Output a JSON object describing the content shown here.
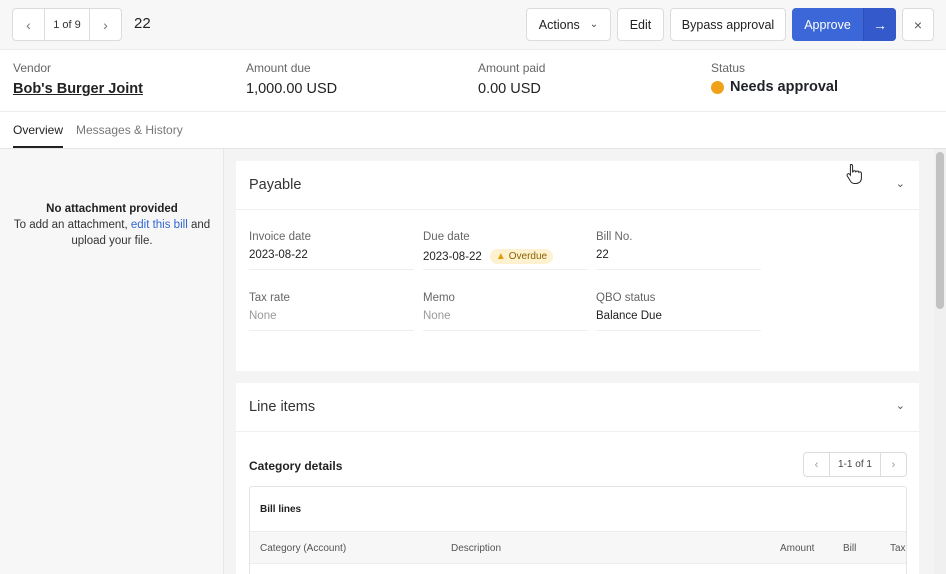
{
  "toolbar": {
    "pager_prev_icon": "chevron-left-icon",
    "pager_count": "1 of 9",
    "pager_next_icon": "chevron-right-icon",
    "record_id": "22",
    "actions_label": "Actions",
    "edit_label": "Edit",
    "bypass_label": "Bypass approval",
    "approve_label": "Approve",
    "approve_arrow": "→",
    "close_glyph": "×",
    "accent_color": "#3b67d9"
  },
  "summary": {
    "vendor_label": "Vendor",
    "vendor_value": "Bob's Burger Joint",
    "amount_due_label": "Amount due",
    "amount_due_value": "1,000.00 USD",
    "amount_paid_label": "Amount paid",
    "amount_paid_value": "0.00 USD",
    "status_label": "Status",
    "status_value": "Needs approval",
    "status_color": "#f0a11a"
  },
  "tabs": [
    {
      "label": "Overview",
      "active": true
    },
    {
      "label": "Messages & History",
      "active": false
    }
  ],
  "attachment": {
    "title": "No attachment provided",
    "text_before": "To add an attachment, ",
    "link_text": "edit this bill",
    "text_after": " and upload your file."
  },
  "payable": {
    "title": "Payable",
    "fields": [
      {
        "label": "Invoice date",
        "value": "2023-08-22"
      },
      {
        "label": "Due date",
        "value": "2023-08-22",
        "badge": "Overdue"
      },
      {
        "label": "Bill No.",
        "value": "22"
      },
      {
        "label": "Tax rate",
        "value": "None"
      },
      {
        "label": "Memo",
        "value": "None"
      },
      {
        "label": "QBO status",
        "value": "Balance Due"
      }
    ]
  },
  "line_items": {
    "title": "Line items",
    "category_title": "Category details",
    "pager_count": "1-1 of 1",
    "bill_lines_title": "Bill lines",
    "columns": [
      "Category (Account)",
      "Description",
      "Amount",
      "Bill",
      "Tax"
    ]
  }
}
